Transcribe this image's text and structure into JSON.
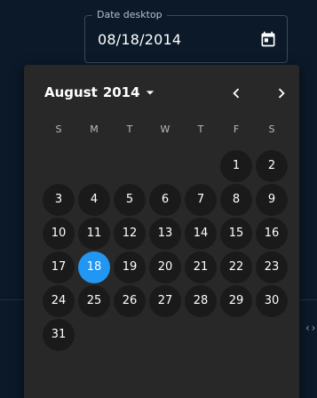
{
  "field": {
    "label": "Date desktop",
    "value": "08/18/2014",
    "icon": "calendar-icon"
  },
  "calendar": {
    "month": "August",
    "year": "2014",
    "weekdays": [
      "S",
      "M",
      "T",
      "W",
      "T",
      "F",
      "S"
    ],
    "first_weekday_index": 5,
    "days_in_month": 31,
    "selected_day": 18,
    "icons": {
      "month_toggle": "arrow-drop-down-icon",
      "prev": "chevron-left-icon",
      "next": "chevron-right-icon"
    }
  },
  "background": {
    "chevrons": "‹ ›"
  },
  "colors": {
    "page_bg": "#0b1929",
    "popup_bg": "#282828",
    "day_bg": "#1a1a1a",
    "accent": "#2196f3"
  }
}
